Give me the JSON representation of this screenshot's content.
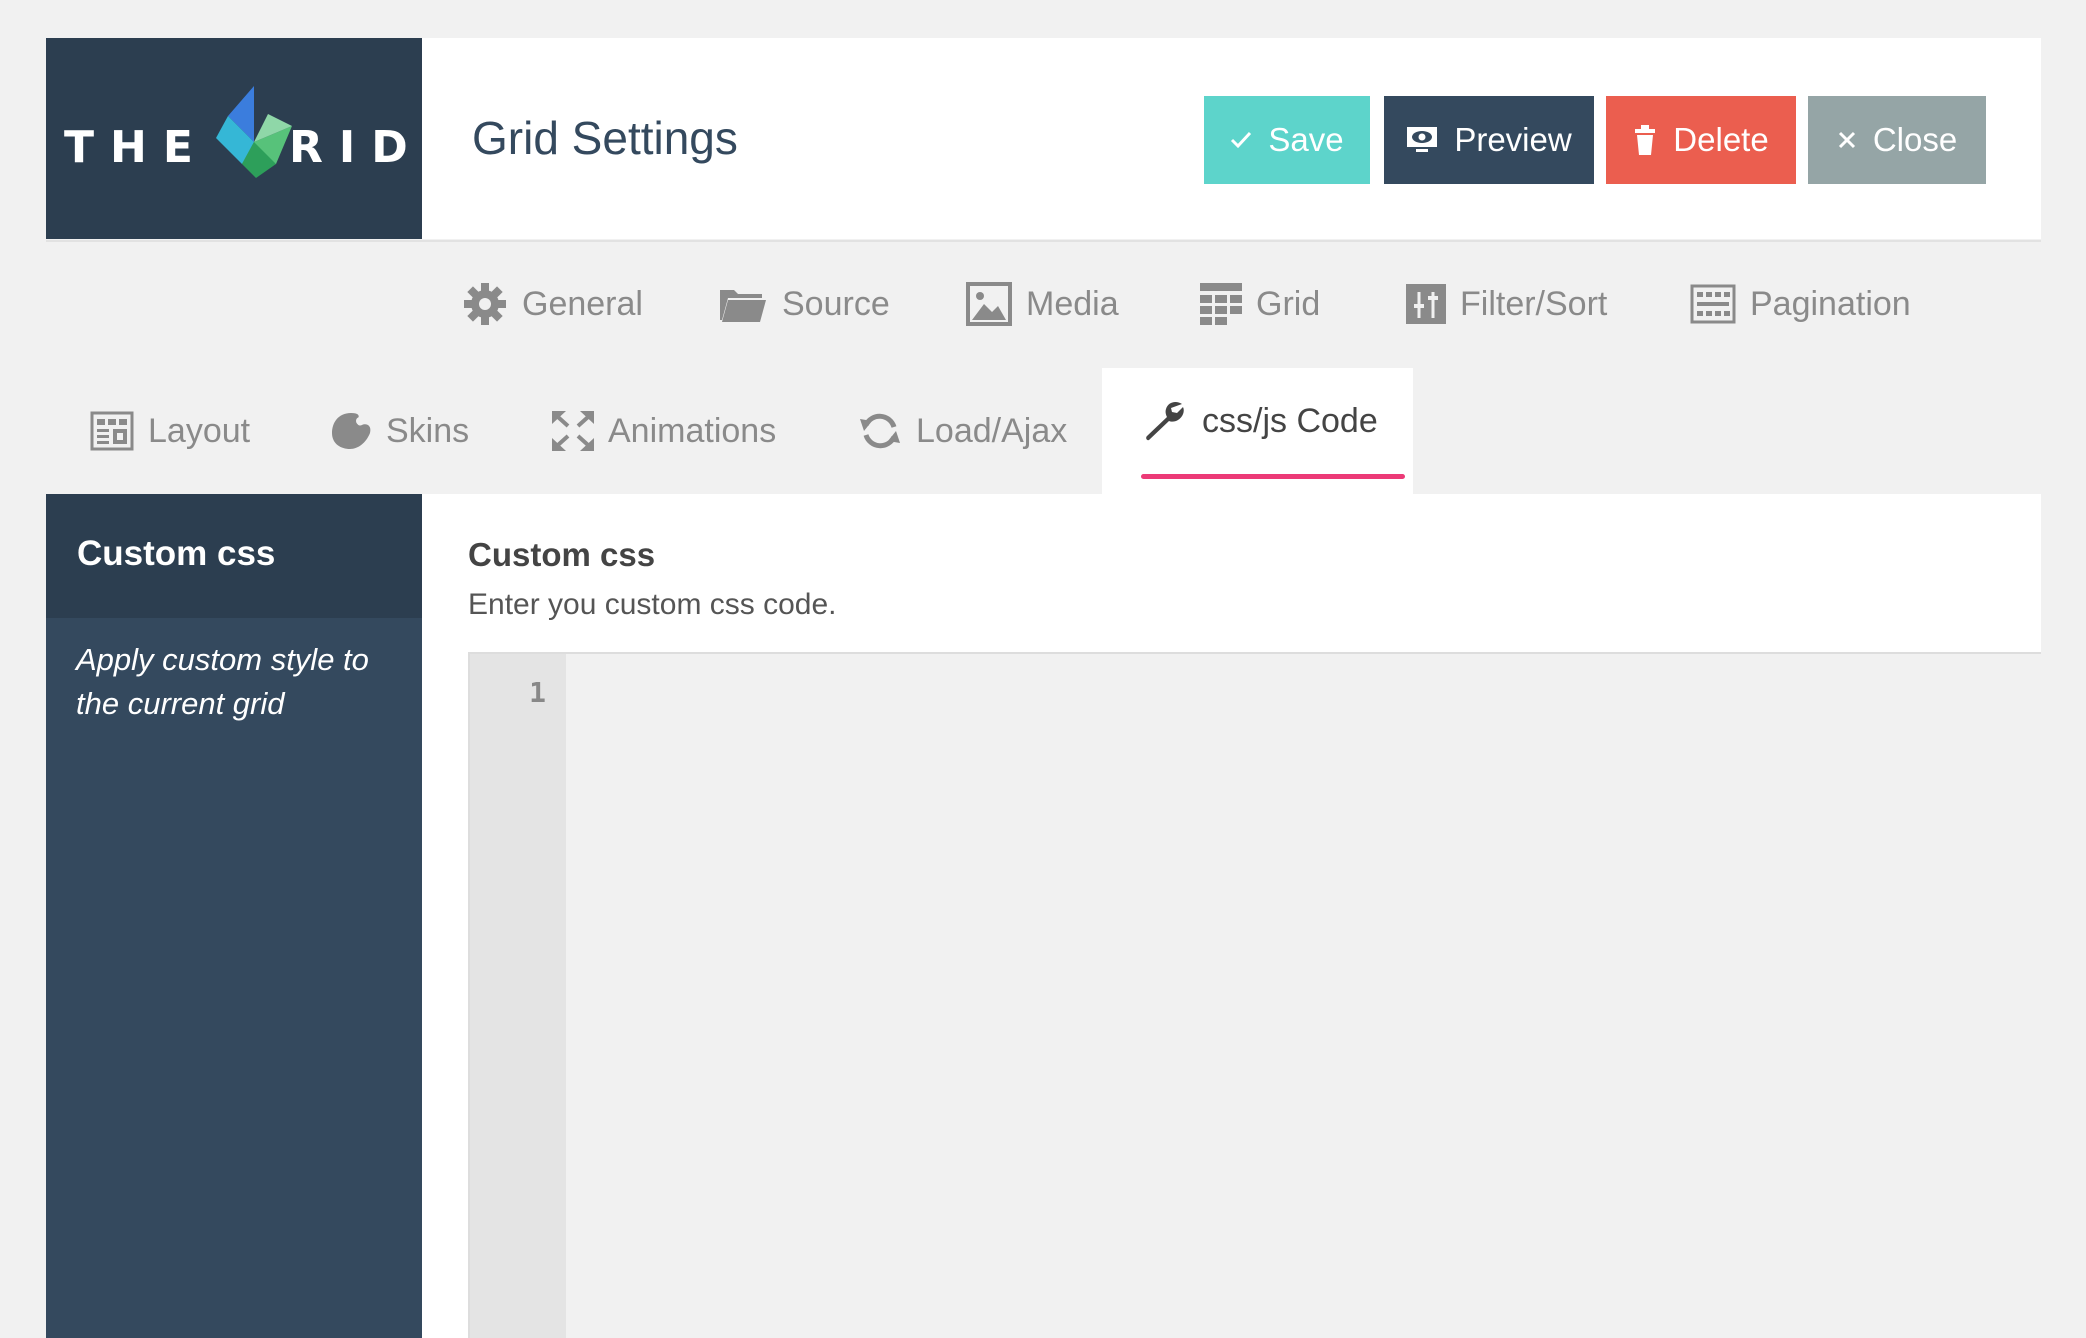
{
  "logo": {
    "text_left": "THE",
    "text_right": "RID",
    "colors": [
      "#3b7ddd",
      "#35b7d6",
      "#57c27a",
      "#2d9f5a"
    ]
  },
  "header": {
    "title": "Grid Settings"
  },
  "toolbar": {
    "save_label": "Save",
    "preview_label": "Preview",
    "delete_label": "Delete",
    "close_label": "Close",
    "colors": {
      "save": "#5dd4cb",
      "preview": "#34495e",
      "delete": "#eb5e4f",
      "close": "#95a5a6"
    }
  },
  "tabs": {
    "row1": [
      {
        "label": "General",
        "icon": "gear-icon"
      },
      {
        "label": "Source",
        "icon": "folder-icon"
      },
      {
        "label": "Media",
        "icon": "image-icon"
      },
      {
        "label": "Grid",
        "icon": "grid-icon"
      },
      {
        "label": "Filter/Sort",
        "icon": "sliders-icon"
      },
      {
        "label": "Pagination",
        "icon": "pagination-icon"
      }
    ],
    "row2": [
      {
        "label": "Layout",
        "icon": "layout-icon"
      },
      {
        "label": "Skins",
        "icon": "palette-icon"
      },
      {
        "label": "Animations",
        "icon": "expand-icon"
      },
      {
        "label": "Load/Ajax",
        "icon": "refresh-icon"
      },
      {
        "label": "css/js Code",
        "icon": "wrench-icon",
        "active": true
      }
    ],
    "active_underline_color": "#ec3a77"
  },
  "sidebar": {
    "title": "Custom css",
    "description": "Apply custom style to the current grid"
  },
  "main": {
    "section_title": "Custom css",
    "section_description": "Enter you custom css code.",
    "editor": {
      "line_numbers": [
        "1"
      ],
      "content": ""
    }
  }
}
